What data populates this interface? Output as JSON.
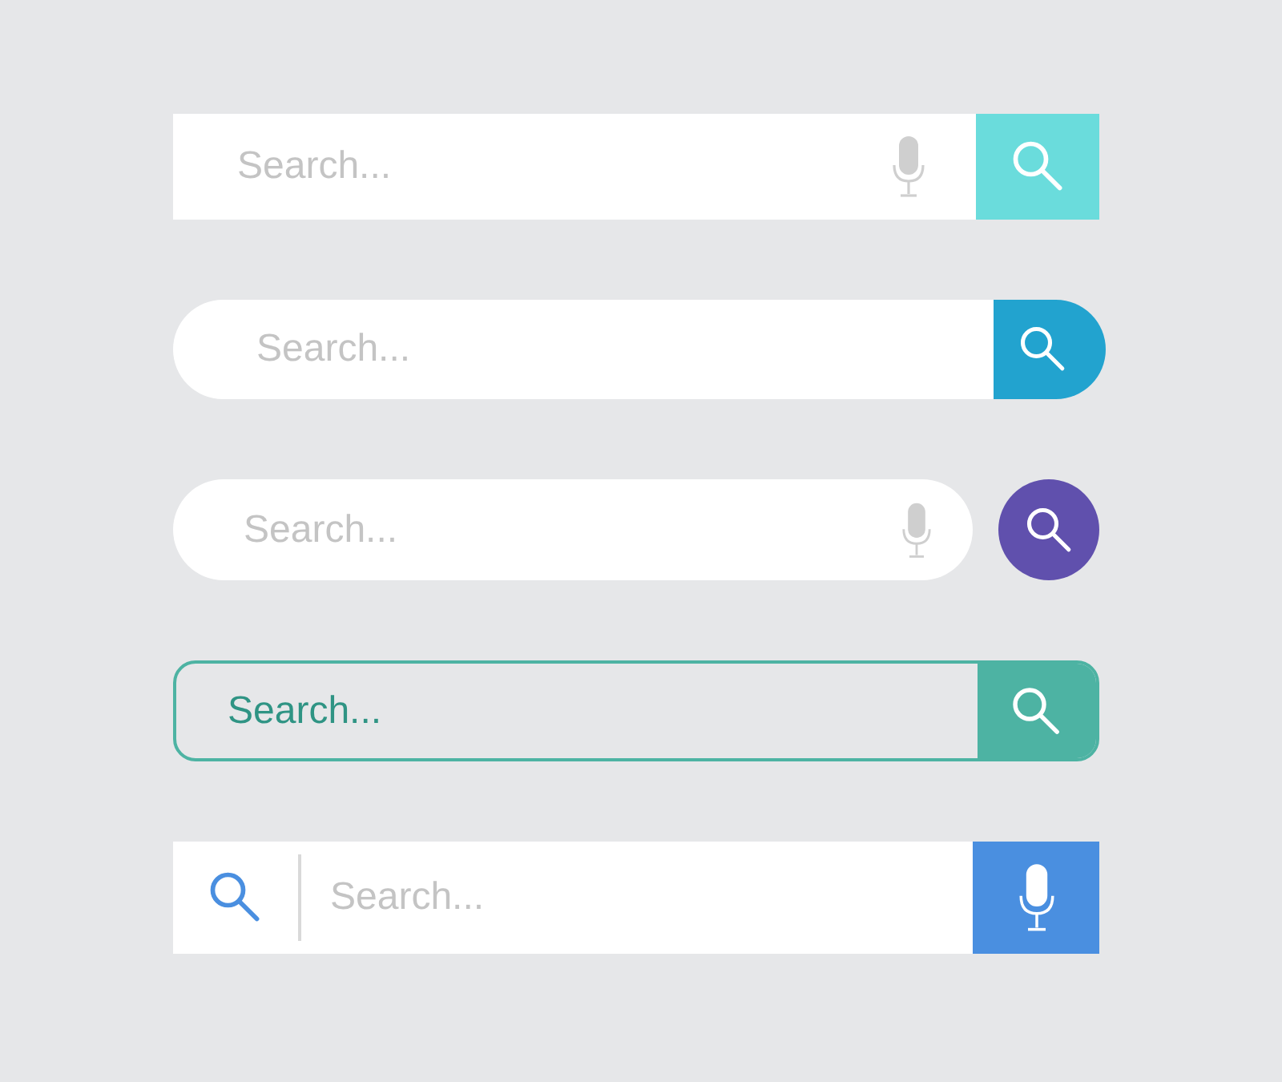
{
  "search_bars": [
    {
      "kind": "square-mic",
      "placeholder": "Search...",
      "color": "#6adcdc"
    },
    {
      "kind": "pill",
      "placeholder": "Search...",
      "color": "#22a3cf"
    },
    {
      "kind": "pill-mic-circle",
      "placeholder": "Search...",
      "color": "#6050ad"
    },
    {
      "kind": "outlined",
      "placeholder": "Search...",
      "color": "#4db3a3"
    },
    {
      "kind": "leading-icon",
      "placeholder": "Search...",
      "color": "#4a8fe0"
    }
  ]
}
